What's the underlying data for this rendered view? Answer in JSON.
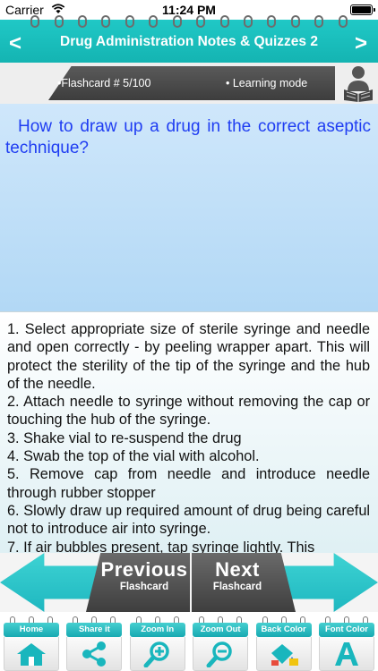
{
  "status": {
    "carrier": "Carrier",
    "time": "11:24 PM"
  },
  "titlebar": {
    "back": "<",
    "title": "Drug Administration Notes & Quizzes 2",
    "forward": ">"
  },
  "header": {
    "flashcard_label": "•Flashcard #  5/100",
    "mode_label": "• Learning mode",
    "reader_icon": "reader-icon"
  },
  "question": {
    "text": "How to draw up a drug in the correct aseptic technique?"
  },
  "answer": {
    "lines": [
      "1. Select appropriate size of sterile syringe and needle and open correctly - by peeling wrapper apart. This will protect the sterility of the tip of the syringe and the hub of the needle.",
      "2. Attach needle to syringe without removing the cap or touching the hub of the syringe.",
      "3. Shake vial to re-suspend the drug",
      "4. Swab the top of the vial with alcohol.",
      "5. Remove cap from needle and introduce needle through rubber stopper",
      "6. Slowly draw up required amount of drug being careful not to introduce air into syringe.",
      "7. If air bubbles present, tap syringe lightly. This"
    ]
  },
  "nav": {
    "previous_big": "Previous",
    "previous_small": "Flashcard",
    "next_big": "Next",
    "next_small": "Flashcard"
  },
  "toolbar": {
    "items": [
      {
        "label": "Home",
        "icon": "home-icon"
      },
      {
        "label": "Share it",
        "icon": "share-icon"
      },
      {
        "label": "Zoom In",
        "icon": "zoom-in-icon"
      },
      {
        "label": "Zoom Out",
        "icon": "zoom-out-icon"
      },
      {
        "label": "Back Color",
        "icon": "back-color-icon"
      },
      {
        "label": "Font Color",
        "icon": "font-color-icon"
      }
    ]
  },
  "colors": {
    "accent": "#1eb7c0",
    "question_text": "#1f3df2",
    "dark_panel": "#4a4a4a"
  }
}
